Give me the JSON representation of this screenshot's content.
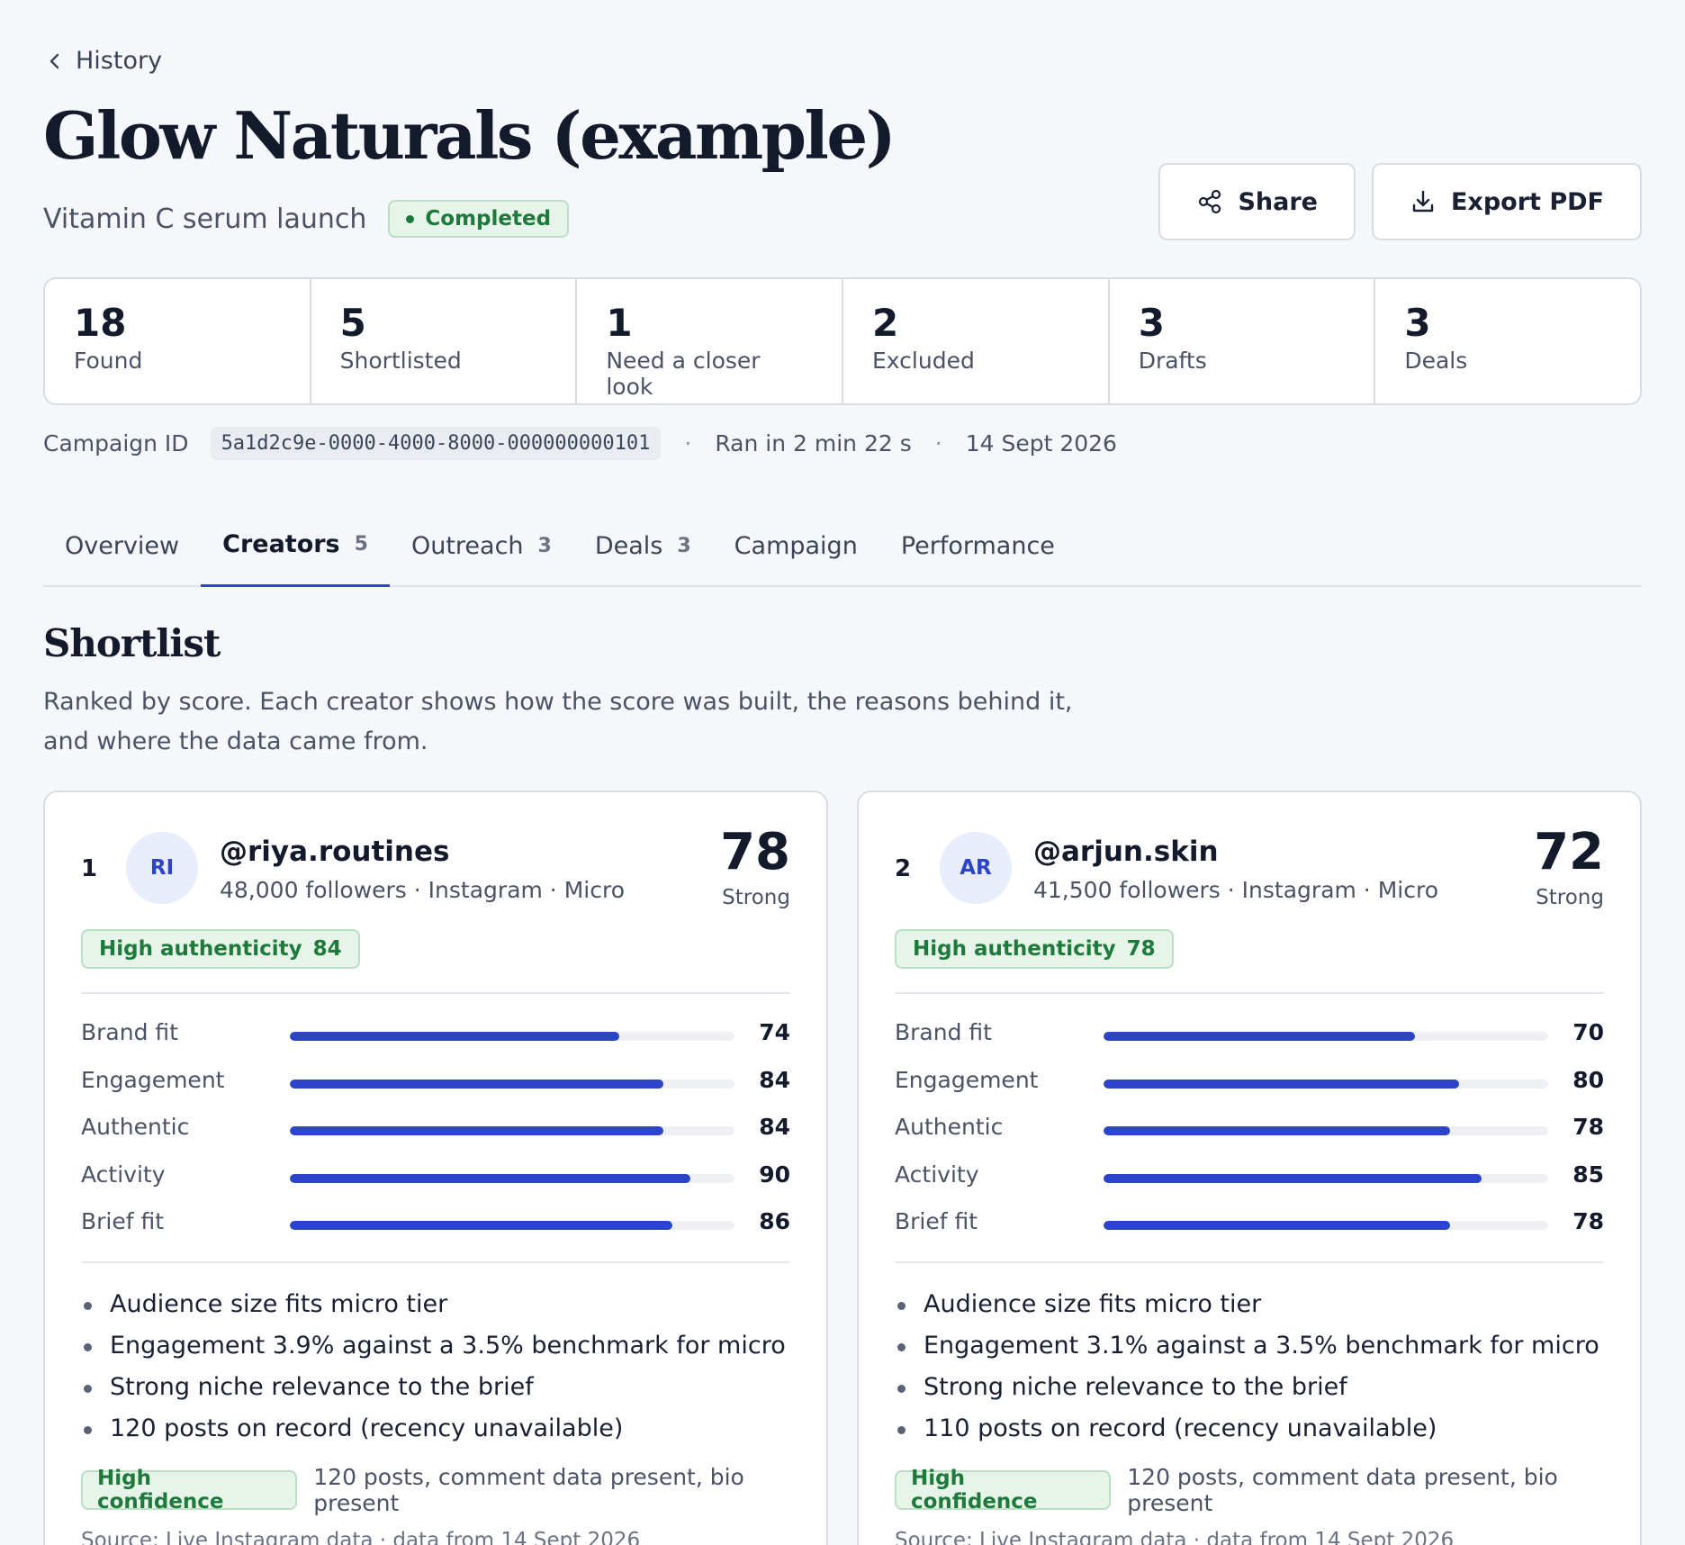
{
  "nav": {
    "back_label": "History"
  },
  "header": {
    "title": "Glow Naturals (example)",
    "subtitle": "Vitamin C serum launch",
    "status": "Completed",
    "share_label": "Share",
    "export_label": "Export PDF"
  },
  "stats": [
    {
      "value": "18",
      "label": "Found"
    },
    {
      "value": "5",
      "label": "Shortlisted"
    },
    {
      "value": "1",
      "label": "Need a closer look"
    },
    {
      "value": "2",
      "label": "Excluded"
    },
    {
      "value": "3",
      "label": "Drafts"
    },
    {
      "value": "3",
      "label": "Deals"
    }
  ],
  "meta": {
    "campaign_id_label": "Campaign ID",
    "campaign_id": "5a1d2c9e-0000-4000-8000-000000000101",
    "separator": "·",
    "runtime": "Ran in 2 min 22 s",
    "date": "14 Sept 2026"
  },
  "tabs": [
    {
      "label": "Overview",
      "count": ""
    },
    {
      "label": "Creators",
      "count": "5"
    },
    {
      "label": "Outreach",
      "count": "3"
    },
    {
      "label": "Deals",
      "count": "3"
    },
    {
      "label": "Campaign",
      "count": ""
    },
    {
      "label": "Performance",
      "count": ""
    }
  ],
  "active_tab": "Creators",
  "section": {
    "title": "Shortlist",
    "description": "Ranked by score. Each creator shows how the score was built, the reasons behind it, and where the data came from."
  },
  "colors": {
    "accent": "#2b44c9",
    "success": "#1e7a3a",
    "success_bg": "#e6f4ea",
    "text": "#131a2c"
  },
  "creators": [
    {
      "rank": "1",
      "initials": "RI",
      "handle": "@riya.routines",
      "details": "48,000 followers · Instagram · Micro",
      "score": "78",
      "score_label": "Strong",
      "authenticity_label": "High authenticity",
      "authenticity_score": "84",
      "metrics": [
        {
          "label": "Brand fit",
          "value": 74
        },
        {
          "label": "Engagement",
          "value": 84
        },
        {
          "label": "Authentic",
          "value": 84
        },
        {
          "label": "Activity",
          "value": 90
        },
        {
          "label": "Brief fit",
          "value": 86
        }
      ],
      "reasons": [
        "Audience size fits micro tier",
        "Engagement 3.9% against a 3.5% benchmark for micro",
        "Strong niche relevance to the brief",
        "120 posts on record (recency unavailable)"
      ],
      "confidence_label": "High confidence",
      "confidence_detail": "120 posts, comment data present, bio present",
      "source": "Source: Live Instagram data · data from 14 Sept 2026"
    },
    {
      "rank": "2",
      "initials": "AR",
      "handle": "@arjun.skin",
      "details": "41,500 followers · Instagram · Micro",
      "score": "72",
      "score_label": "Strong",
      "authenticity_label": "High authenticity",
      "authenticity_score": "78",
      "metrics": [
        {
          "label": "Brand fit",
          "value": 70
        },
        {
          "label": "Engagement",
          "value": 80
        },
        {
          "label": "Authentic",
          "value": 78
        },
        {
          "label": "Activity",
          "value": 85
        },
        {
          "label": "Brief fit",
          "value": 78
        }
      ],
      "reasons": [
        "Audience size fits micro tier",
        "Engagement 3.1% against a 3.5% benchmark for micro",
        "Strong niche relevance to the brief",
        "110 posts on record (recency unavailable)"
      ],
      "confidence_label": "High confidence",
      "confidence_detail": "120 posts, comment data present, bio present",
      "source": "Source: Live Instagram data · data from 14 Sept 2026"
    }
  ]
}
